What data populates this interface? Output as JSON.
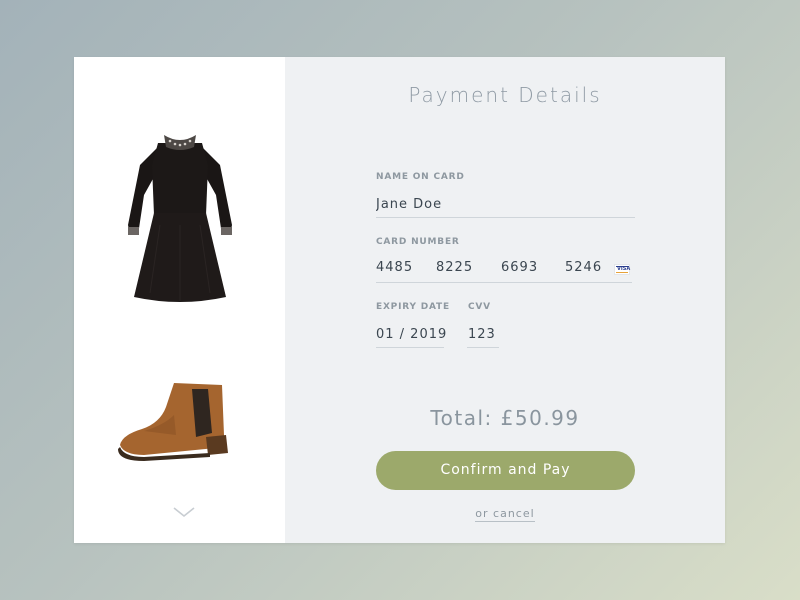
{
  "form": {
    "title": "Payment Details",
    "name_label": "NAME ON CARD",
    "name_value": "Jane Doe",
    "card_label": "CARD NUMBER",
    "card_groups": [
      "4485",
      "8225",
      "6693",
      "5246"
    ],
    "card_icon": "visa-icon",
    "expiry_label": "EXPIRY DATE",
    "expiry_value": "01 / 2019",
    "cvv_label": "CVV",
    "cvv_value": "123"
  },
  "summary": {
    "total": "Total: £50.99"
  },
  "actions": {
    "confirm_label": "Confirm and Pay",
    "cancel_label": "or cancel"
  },
  "products": {
    "items": [
      "black-dress-image",
      "tan-chelsea-boot-image"
    ],
    "scroll_icon": "chevron-down-icon"
  },
  "colors": {
    "accent": "#9ca96b",
    "panel": "#eff1f3",
    "label": "#8e98a0",
    "text": "#3b4650"
  }
}
